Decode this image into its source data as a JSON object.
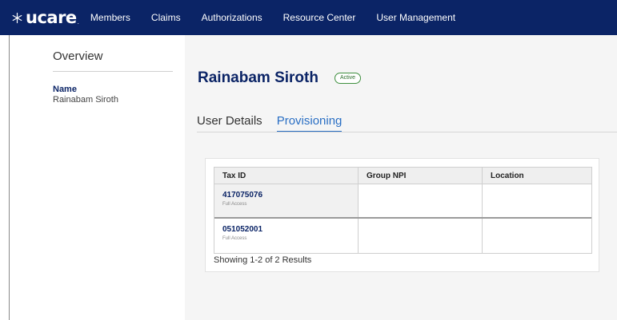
{
  "nav": {
    "logo_text": "ucare",
    "logo_mark": ".",
    "items": [
      "Members",
      "Claims",
      "Authorizations",
      "Resource Center",
      "User Management"
    ]
  },
  "sidebar": {
    "overview_label": "Overview",
    "name_label": "Name",
    "name_value": "Rainabam Siroth"
  },
  "user": {
    "name": "Rainabam Siroth",
    "status": "Active"
  },
  "tabs": [
    {
      "label": "User Details",
      "active": false
    },
    {
      "label": "Provisioning",
      "active": true
    }
  ],
  "table": {
    "columns": [
      "Tax ID",
      "Group NPI",
      "Location"
    ],
    "rows": [
      {
        "tax_id": "417075076",
        "access": "Full Access",
        "group_npi": "",
        "location": ""
      },
      {
        "tax_id": "051052001",
        "access": "Full Access",
        "group_npi": "",
        "location": ""
      }
    ],
    "results_text": "Showing 1-2 of 2 Results"
  },
  "colors": {
    "brand_navy": "#0b2466",
    "tab_active": "#2a6fc4",
    "status_green": "#3f8f3f"
  },
  "icons": {
    "logo": "snowflake-icon"
  }
}
